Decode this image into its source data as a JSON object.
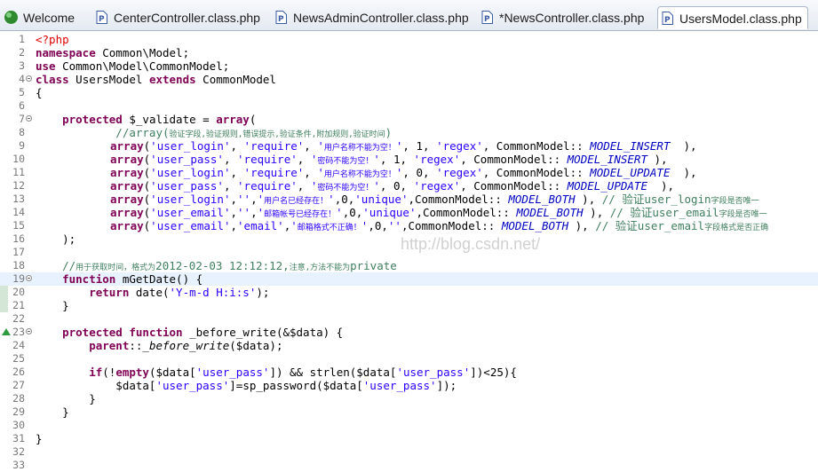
{
  "tabs": [
    {
      "label": "Welcome",
      "icon": "eclipse-welcome-icon"
    },
    {
      "label": "CenterController.class.php",
      "icon": "php-file-icon"
    },
    {
      "label": "NewsAdminController.class.php",
      "icon": "php-file-icon"
    },
    {
      "label": "*NewsController.class.php",
      "icon": "php-file-icon"
    },
    {
      "label": "UsersModel.class.php",
      "icon": "php-file-icon",
      "active": true
    }
  ],
  "watermark": "http://blog.csdn.net/",
  "editor": {
    "line_numbers": [
      "1",
      "2",
      "3",
      "4",
      "5",
      "6",
      "7",
      "8",
      "9",
      "10",
      "11",
      "12",
      "13",
      "14",
      "15",
      "16",
      "17",
      "18",
      "19",
      "20",
      "21",
      "22",
      "23",
      "24",
      "25",
      "26",
      "27",
      "28",
      "29",
      "30",
      "31",
      "32",
      "33"
    ],
    "code": {
      "l1": "<?php",
      "l2a": "namespace",
      "l2b": " Common\\Model;",
      "l3a": "use",
      "l3b": " Common\\Model\\CommonModel;",
      "l4a": "class",
      "l4b": " UsersModel ",
      "l4c": "extends",
      "l4d": " CommonModel",
      "l5": "{",
      "l7a": "    protected",
      "l7b": " $_validate = ",
      "l7c": "array",
      "l7d": "(",
      "l8a": "            //array(",
      "l8b": "验证字段,验证规则,错误提示,验证条件,附加规则,验证时间",
      "l8c": ")",
      "l9a": "array",
      "l9b": "(",
      "l9c": "'user_login'",
      "l9d": ", ",
      "l9e": "'require'",
      "l9f": ", ",
      "l9g": "'",
      "l9h": "用户名称不能为空！",
      "l9i": "'",
      "l9j": ", 1, ",
      "l9k": "'regex'",
      "l9l": ", CommonModel:: ",
      "l9m": "MODEL_INSERT",
      "l9n": "  ),",
      "l10a": "array",
      "l10b": "(",
      "l10c": "'user_pass'",
      "l10d": ", ",
      "l10e": "'require'",
      "l10f": ", ",
      "l10g": "'",
      "l10h": "密码不能为空！",
      "l10i": "'",
      "l10j": ", 1, ",
      "l10k": "'regex'",
      "l10l": ", CommonModel:: ",
      "l10m": "MODEL_INSERT",
      "l10n": " ),",
      "l11a": "array",
      "l11b": "(",
      "l11c": "'user_login'",
      "l11d": ", ",
      "l11e": "'require'",
      "l11f": ", ",
      "l11g": "'",
      "l11h": "用户名称不能为空！",
      "l11i": "'",
      "l11j": ", 0, ",
      "l11k": "'regex'",
      "l11l": ", CommonModel:: ",
      "l11m": "MODEL_UPDATE",
      "l11n": "  ),",
      "l12a": "array",
      "l12b": "(",
      "l12c": "'user_pass'",
      "l12d": ", ",
      "l12e": "'require'",
      "l12f": ", ",
      "l12g": "'",
      "l12h": "密码不能为空！",
      "l12i": "'",
      "l12j": ", 0, ",
      "l12k": "'regex'",
      "l12l": ", CommonModel:: ",
      "l12m": "MODEL_UPDATE",
      "l12n": "  ),",
      "l13a": "array",
      "l13b": "(",
      "l13c": "'user_login'",
      "l13d": ",",
      "l13e": "''",
      "l13f": ",",
      "l13g": "'",
      "l13h": "用户名已经存在！",
      "l13i": "'",
      "l13j": ",0,",
      "l13k": "'unique'",
      "l13l": ",CommonModel:: ",
      "l13m": "MODEL_BOTH",
      "l13n": " ), ",
      "l13o": "// 验证user_login",
      "l13p": "字段是否唯一",
      "l14a": "array",
      "l14b": "(",
      "l14c": "'user_email'",
      "l14d": ",",
      "l14e": "''",
      "l14f": ",",
      "l14g": "'",
      "l14h": "邮箱帐号已经存在！",
      "l14i": "'",
      "l14j": ",0,",
      "l14k": "'unique'",
      "l14l": ",CommonModel:: ",
      "l14m": "MODEL_BOTH",
      "l14n": " ), ",
      "l14o": "// 验证user_email",
      "l14p": "字段是否唯一",
      "l15a": "array",
      "l15b": "(",
      "l15c": "'user_email'",
      "l15d": ",",
      "l15e": "'email'",
      "l15f": ",",
      "l15g": "'",
      "l15h": "邮箱格式不正确！",
      "l15i": "'",
      "l15j": ",0,",
      "l15k": "''",
      "l15l": ",CommonModel:: ",
      "l15m": "MODEL_BOTH",
      "l15n": " ), ",
      "l15o": "// 验证user_email",
      "l15p": "字段格式是否正确",
      "l16": "    );",
      "l18a": "    //",
      "l18b": "用于获取时间，格式为",
      "l18c": "2012-02-03 12:12:12,",
      "l18d": "注意,方法不能为",
      "l18e": "private",
      "l19a": "    function",
      "l19b": " mGetDate() {",
      "l20a": "        return",
      "l20b": " date(",
      "l20c": "'Y-m-d H:i:s'",
      "l20d": ");",
      "l21": "    }",
      "l23a": "    protected",
      "l23b": " ",
      "l23c": "function",
      "l23d": " _before_write(&$data) {",
      "l24a": "        parent",
      "l24b": "::",
      "l24c": "_before_write",
      "l24d": "($data);",
      "l26a": "        if",
      "l26b": "(!",
      "l26c": "empty",
      "l26d": "($data[",
      "l26e": "'user_pass'",
      "l26f": "]) && strlen($data[",
      "l26g": "'user_pass'",
      "l26h": "])<25){",
      "l27a": "            $data[",
      "l27b": "'user_pass'",
      "l27c": "]=sp_password($data[",
      "l27d": "'user_pass'",
      "l27e": "]);",
      "l28": "        }",
      "l29": "    }",
      "l31": "}"
    }
  }
}
